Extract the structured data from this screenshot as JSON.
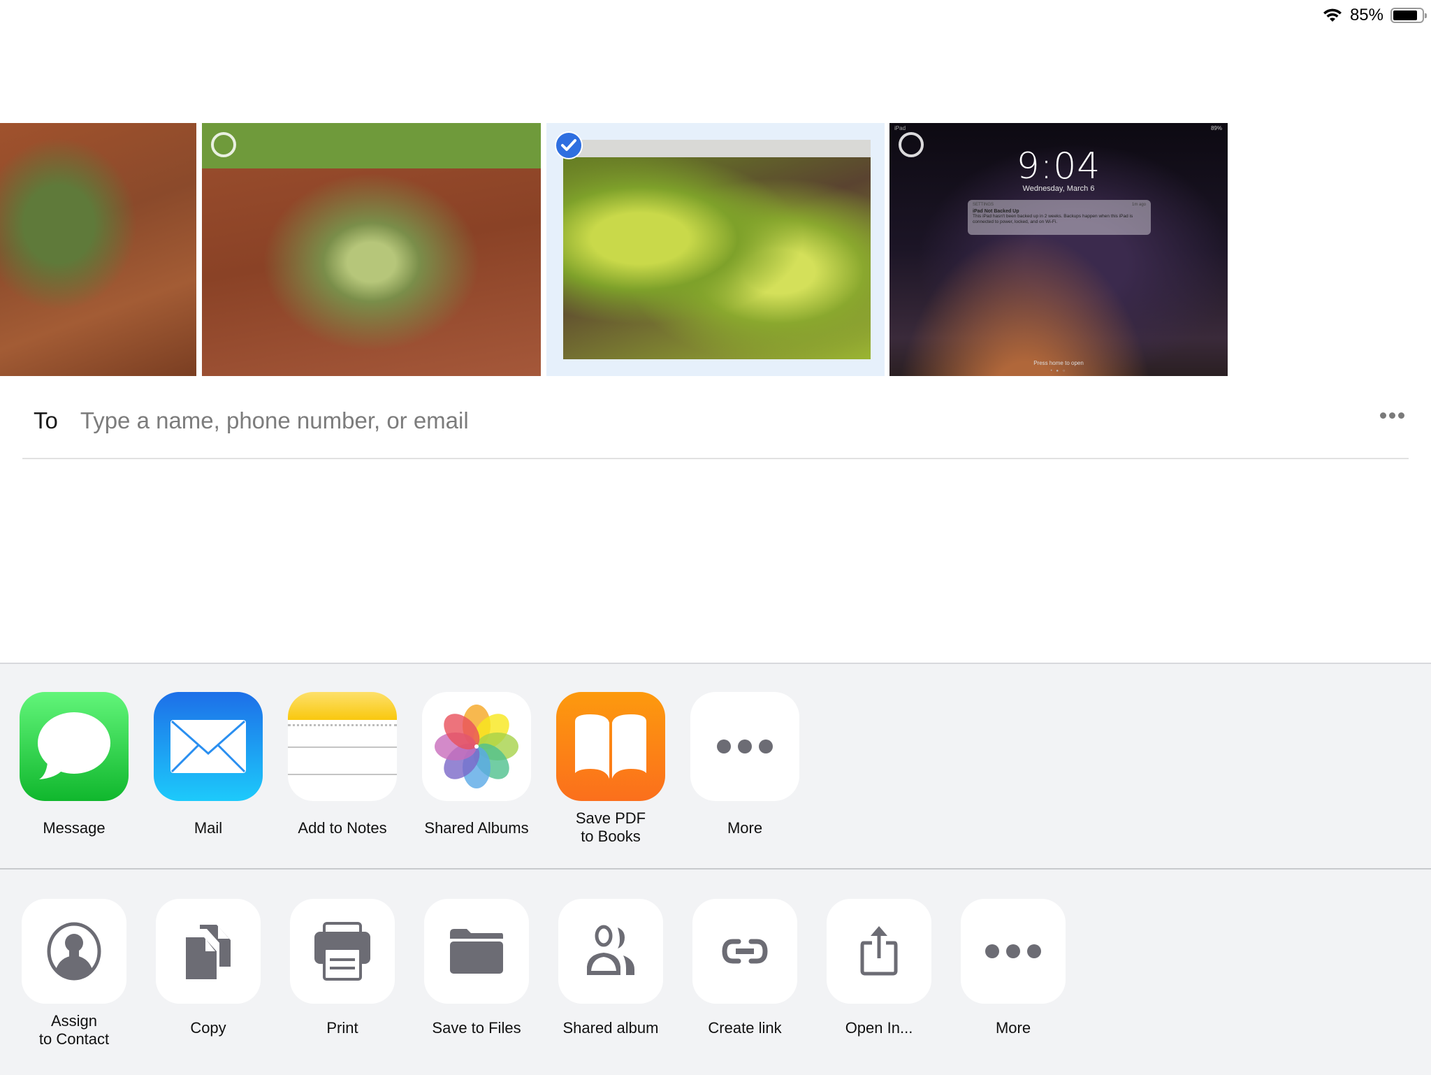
{
  "status_bar": {
    "wifi_icon": "wifi-icon",
    "battery_percent": "85%",
    "battery_level": 0.85
  },
  "photos": [
    {
      "name": "plant-photo-1",
      "selected": false,
      "partially_visible": true
    },
    {
      "name": "plant-photo-2",
      "selected": false
    },
    {
      "name": "plant-photo-3",
      "selected": true
    },
    {
      "name": "lock-screen-screenshot",
      "selected": false,
      "content": {
        "device_label": "iPad",
        "status": "89%",
        "time": "9:04",
        "date": "Wednesday, March 6",
        "notification": {
          "app": "SETTINGS",
          "age": "1m ago",
          "title": "iPad Not Backed Up",
          "body": "This iPad hasn't been backed up in 2 weeks. Backups happen when this iPad is connected to power, locked, and on Wi-Fi."
        },
        "hint": "Press home to open",
        "page_dots": "• ● ○"
      }
    }
  ],
  "recipient": {
    "label": "To",
    "placeholder": "Type a name, phone number, or email",
    "value": "",
    "more_icon": "ellipsis-icon"
  },
  "share_sheet": {
    "apps": [
      {
        "label": "Message",
        "icon": "messages-app-icon"
      },
      {
        "label": "Mail",
        "icon": "mail-app-icon"
      },
      {
        "label": "Add to Notes",
        "icon": "notes-app-icon"
      },
      {
        "label": "Shared Albums",
        "icon": "photos-app-icon"
      },
      {
        "label": "Save PDF\nto Books",
        "label_line1": "Save PDF",
        "label_line2": "to Books",
        "icon": "books-app-icon"
      },
      {
        "label": "More",
        "icon": "ellipsis-icon"
      }
    ],
    "actions": [
      {
        "label_line1": "Assign",
        "label_line2": "to Contact",
        "icon": "contact-icon"
      },
      {
        "label": "Copy",
        "icon": "copy-icon"
      },
      {
        "label": "Print",
        "icon": "printer-icon"
      },
      {
        "label": "Save to Files",
        "icon": "folder-icon"
      },
      {
        "label": "Shared album",
        "icon": "shared-album-icon"
      },
      {
        "label": "Create link",
        "icon": "link-icon"
      },
      {
        "label": "Open In...",
        "icon": "share-icon"
      },
      {
        "label": "More",
        "icon": "ellipsis-icon"
      }
    ]
  },
  "colors": {
    "selection_blue": "#2f6fe0",
    "selected_bg": "#e6f0fb",
    "sheet_bg": "#f2f3f5",
    "glyph_gray": "#6c6c74"
  }
}
